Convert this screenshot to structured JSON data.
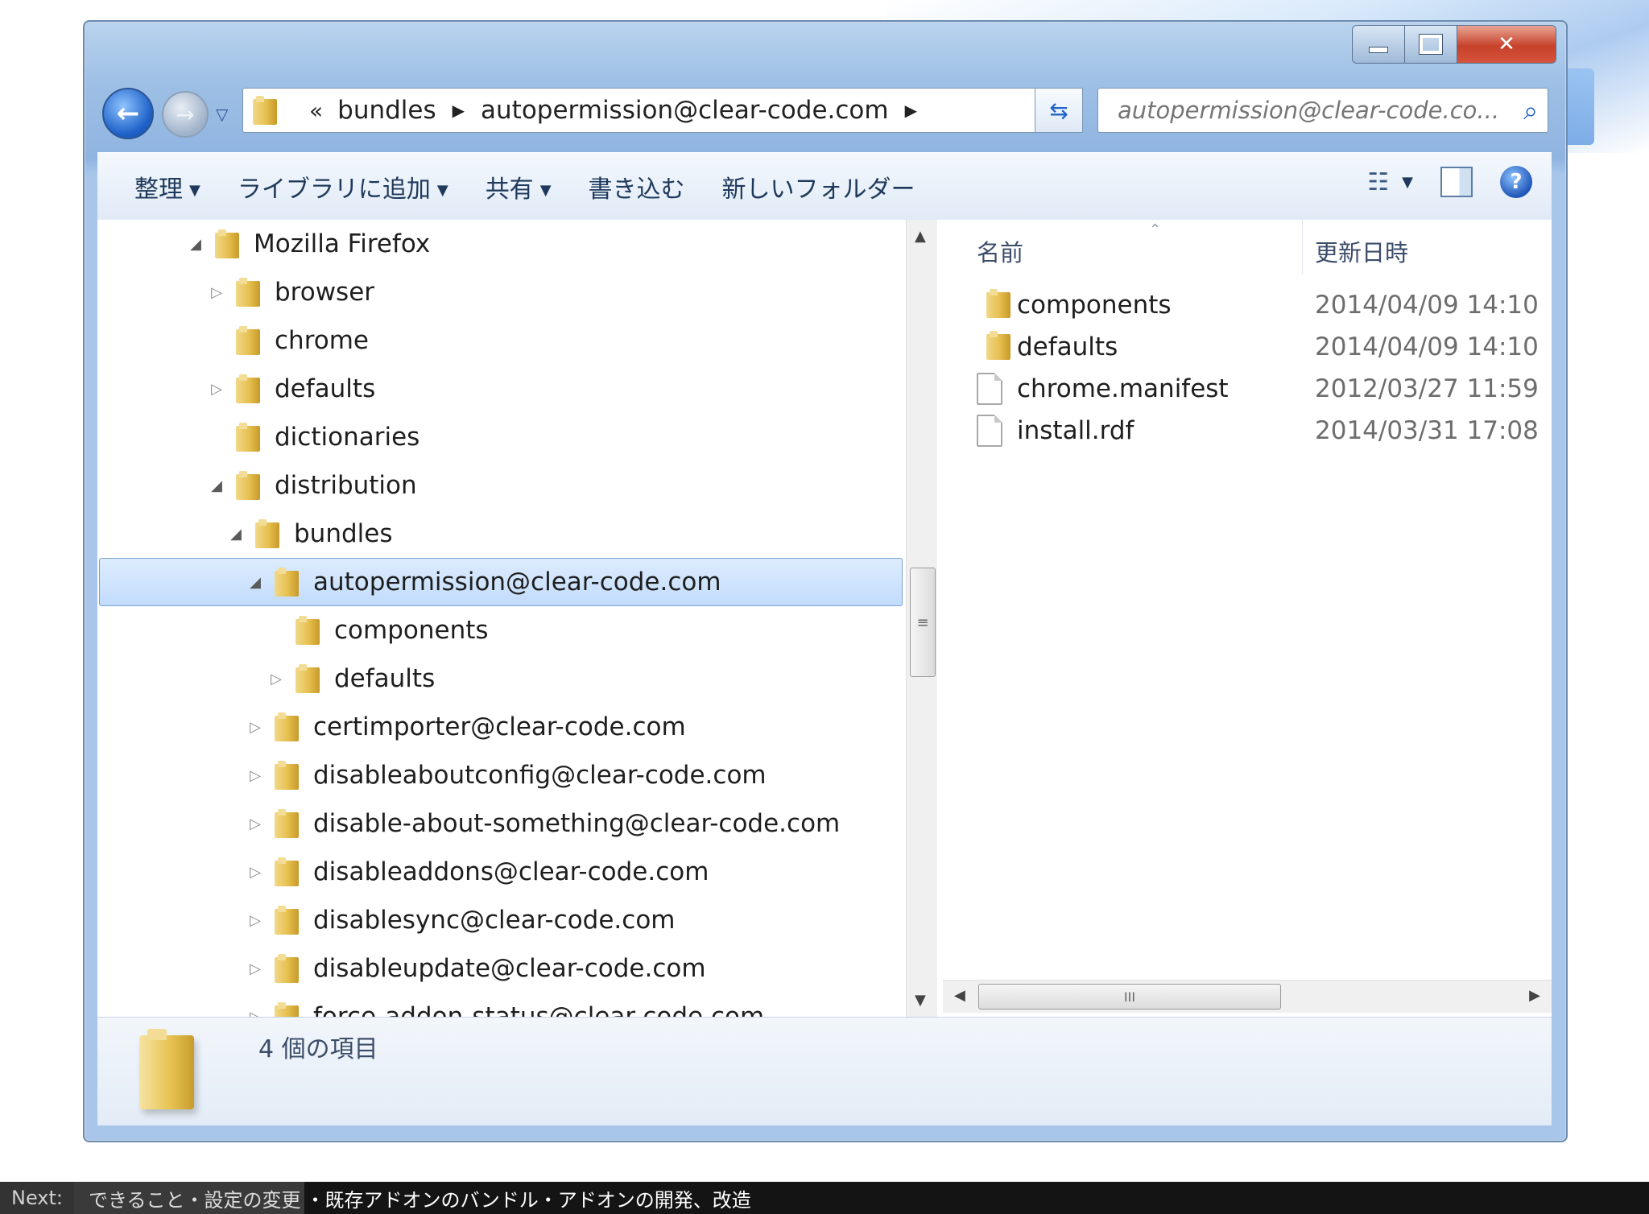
{
  "window": {
    "nav": {
      "breadcrumb_chevron": "«",
      "breadcrumb": [
        "bundles",
        "autopermission@clear-code.com"
      ]
    },
    "search": {
      "placeholder": "autopermission@clear-code.co..."
    },
    "toolbar": {
      "organize": "整理",
      "add_to_library": "ライブラリに追加",
      "share": "共有",
      "burn": "書き込む",
      "new_folder": "新しいフォルダー"
    },
    "tree": [
      {
        "label": "Mozilla Firefox",
        "expanded": true
      },
      {
        "label": "browser",
        "expanded": false
      },
      {
        "label": "chrome"
      },
      {
        "label": "defaults",
        "expanded": false
      },
      {
        "label": "dictionaries"
      },
      {
        "label": "distribution",
        "expanded": true
      },
      {
        "label": "bundles",
        "expanded": true
      },
      {
        "label": "autopermission@clear-code.com",
        "expanded": true,
        "selected": true
      },
      {
        "label": "components"
      },
      {
        "label": "defaults",
        "expanded": false
      },
      {
        "label": "certimporter@clear-code.com",
        "expanded": false
      },
      {
        "label": "disableaboutconfig@clear-code.com",
        "expanded": false
      },
      {
        "label": "disable-about-something@clear-code.com",
        "expanded": false
      },
      {
        "label": "disableaddons@clear-code.com",
        "expanded": false
      },
      {
        "label": "disablesync@clear-code.com",
        "expanded": false
      },
      {
        "label": "disableupdate@clear-code.com",
        "expanded": false
      },
      {
        "label": "force-addon-status@clear-code.com",
        "expanded": false
      }
    ],
    "columns": {
      "name": "名前",
      "modified": "更新日時"
    },
    "files": [
      {
        "name": "components",
        "date": "2014/04/09 14:10",
        "icon": "folder-icon"
      },
      {
        "name": "defaults",
        "date": "2014/04/09 14:10",
        "icon": "folder-icon"
      },
      {
        "name": "chrome.manifest",
        "date": "2012/03/27 11:59",
        "icon": "file-icon"
      },
      {
        "name": "install.rdf",
        "date": "2014/03/31 17:08",
        "icon": "file-icon"
      }
    ],
    "details": {
      "item_count": "4 個の項目"
    }
  },
  "footer": {
    "next_label": "Next:",
    "next_topics_past": "できること・設定の変更",
    "next_topics_upcoming": "・既存アドオンのバンドル・アドオンの開発、改造"
  },
  "colors": {
    "selection": "#c2dcfd",
    "title_bar": "#9dbfe5",
    "close_button": "#c7412a"
  }
}
